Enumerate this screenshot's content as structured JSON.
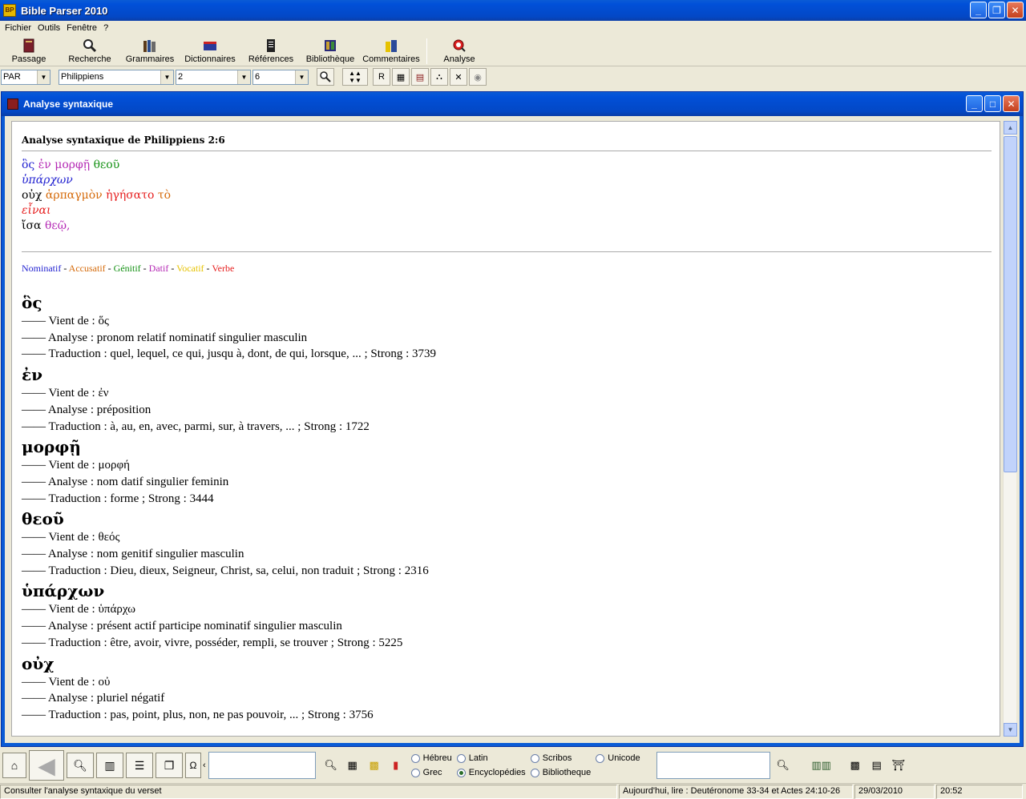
{
  "app": {
    "title": "Bible Parser 2010",
    "icon_text": "BP"
  },
  "menu": [
    "Fichier",
    "Outils",
    "Fenêtre",
    "?"
  ],
  "toolbar": {
    "buttons": [
      {
        "label": "Passage",
        "icon": "book-icon"
      },
      {
        "label": "Recherche",
        "icon": "magnifier-icon"
      },
      {
        "label": "Grammaires",
        "icon": "books-icon"
      },
      {
        "label": "Dictionnaires",
        "icon": "dictionary-icon"
      },
      {
        "label": "Références",
        "icon": "scroll-icon"
      },
      {
        "label": "Bibliothèque",
        "icon": "library-icon"
      },
      {
        "label": "Commentaires",
        "icon": "notes-icon"
      },
      {
        "label": "Analyse",
        "icon": "analysis-icon"
      }
    ]
  },
  "selectors": {
    "version": "PAR",
    "book": "Philippiens",
    "chapter": "2",
    "verse": "6",
    "r_label": "R"
  },
  "child": {
    "title": "Analyse syntaxique"
  },
  "doc": {
    "heading": "Analyse syntaxique de Philippiens 2:6",
    "legend": {
      "nom": "Nominatif",
      "acc": "Accusatif",
      "gen": "Génitif",
      "dat": "Datif",
      "voc": "Vocatif",
      "verb": "Verbe",
      "sep": " - "
    },
    "verse": {
      "l1": [
        "ὃς",
        "ἐν",
        "μορφῇ",
        "θεοῦ"
      ],
      "l2": [
        "ὑπάρχων"
      ],
      "l3": [
        "οὐχ",
        "ἁρπαγμὸν",
        "ἡγήσατο",
        "τὸ"
      ],
      "l4": [
        "εἶναι"
      ],
      "l5": [
        "ἴσα",
        "θεῷ,"
      ]
    },
    "entries": [
      {
        "word": "ὃς",
        "vient": "—— Vient de : ὅς",
        "analyse": "—— Analyse : pronom relatif nominatif singulier masculin",
        "trad": "—— Traduction : quel, lequel, ce qui, jusqu à, dont, de qui, lorsque, ... ; Strong : 3739"
      },
      {
        "word": "ἐν",
        "vient": "—— Vient de : ἐν",
        "analyse": "—— Analyse : préposition",
        "trad": "—— Traduction : à, au, en, avec, parmi, sur, à travers, ... ; Strong : 1722"
      },
      {
        "word": "μορφῇ",
        "vient": "—— Vient de : μορφή",
        "analyse": "—— Analyse : nom datif singulier feminin",
        "trad": "—— Traduction : forme ; Strong : 3444"
      },
      {
        "word": "θεοῦ",
        "vient": "—— Vient de : θεός",
        "analyse": "—— Analyse : nom genitif singulier masculin",
        "trad": "—— Traduction : Dieu, dieux, Seigneur, Christ, sa, celui, non traduit ; Strong : 2316"
      },
      {
        "word": "ὑπάρχων",
        "vient": "—— Vient de : ὑπάρχω",
        "analyse": "—— Analyse : présent actif participe nominatif singulier masculin",
        "trad": "—— Traduction : être, avoir, vivre, posséder, rempli, se trouver ; Strong : 5225"
      },
      {
        "word": "οὐχ",
        "vient": "—— Vient de : οὐ",
        "analyse": "—— Analyse : pluriel négatif",
        "trad": "—— Traduction : pas, point, plus, non, ne pas pouvoir, ... ; Strong : 3756"
      }
    ]
  },
  "bottom": {
    "radios": [
      {
        "label": "Hébreu",
        "checked": false
      },
      {
        "label": "Latin",
        "checked": false
      },
      {
        "label": "Scribos",
        "checked": false
      },
      {
        "label": "Unicode",
        "checked": false
      },
      {
        "label": "Grec",
        "checked": false
      },
      {
        "label": "Encyclopédies",
        "checked": true
      },
      {
        "label": "Bibliotheque",
        "checked": false
      }
    ]
  },
  "status": {
    "message": "Consulter l'analyse syntaxique du verset",
    "reading": "Aujourd'hui, lire : Deutéronome 33-34 et Actes 24:10-26",
    "date": "29/03/2010",
    "time": "20:52"
  },
  "colors": {
    "nominatif": "#1f1fd0",
    "accusatif": "#d56a0a",
    "genitif": "#149114",
    "datif": "#b52ab5",
    "vocatif": "#e6c200",
    "verbe": "#e61e1e"
  }
}
